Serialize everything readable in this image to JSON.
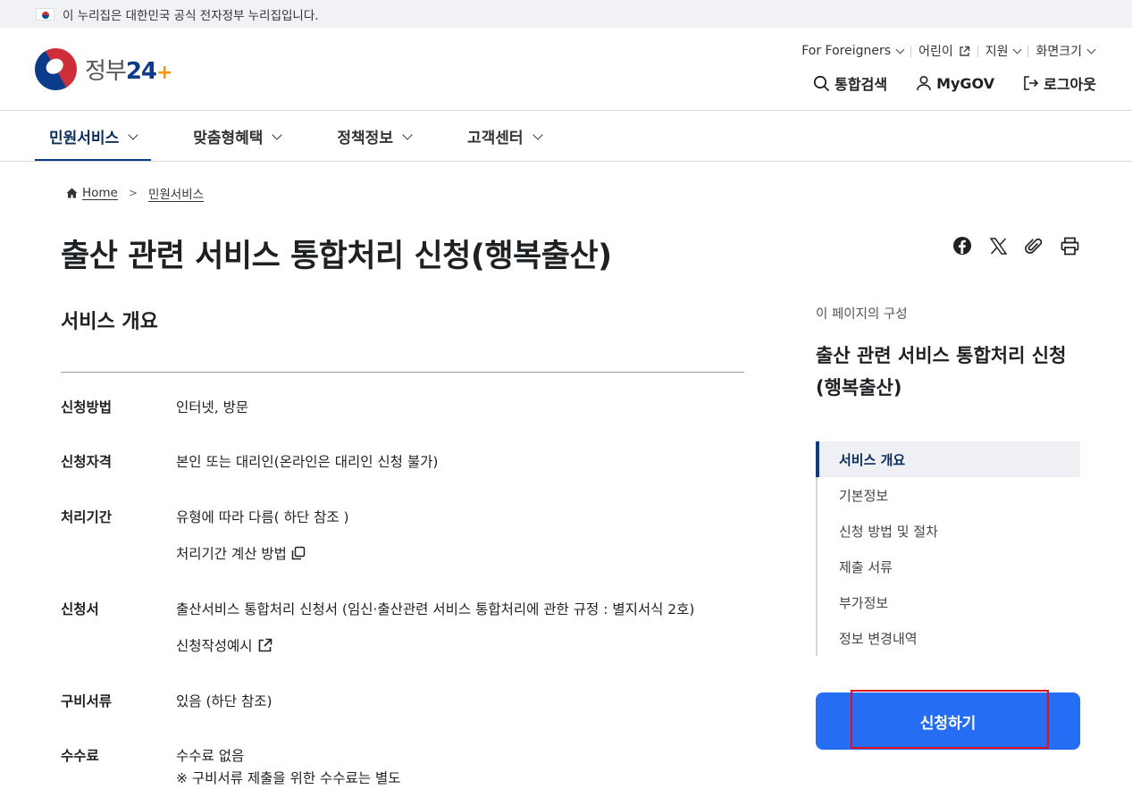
{
  "gov_banner": {
    "text": "이 누리집은 대한민국 공식 전자정부 누리집입니다."
  },
  "logo": {
    "text_main": "정부",
    "text_num": "24",
    "text_plus": "+"
  },
  "utility": [
    {
      "label": "For Foreigners",
      "icon": "chevron-down-icon"
    },
    {
      "label": "어린이",
      "icon": "external-link-icon"
    },
    {
      "label": "지원",
      "icon": "chevron-down-icon"
    },
    {
      "label": "화면크기",
      "icon": "chevron-down-icon"
    }
  ],
  "tools": {
    "search": "통합검색",
    "mygov": "MyGOV",
    "logout": "로그아웃"
  },
  "nav": [
    {
      "label": "민원서비스",
      "active": true
    },
    {
      "label": "맞춤형혜택",
      "active": false
    },
    {
      "label": "정책정보",
      "active": false
    },
    {
      "label": "고객센터",
      "active": false
    }
  ],
  "breadcrumb": {
    "home": "Home",
    "current": "민원서비스"
  },
  "page_title": "출산 관련 서비스 통합처리 신청(행복출산)",
  "section_title": "서비스 개요",
  "overview": {
    "method_label": "신청방법",
    "method_value": "인터넷, 방문",
    "eligibility_label": "신청자격",
    "eligibility_value": "본인 또는 대리인(온라인은 대리인 신청 불가)",
    "period_label": "처리기간",
    "period_value": "유형에 따라 다름( 하단 참조 )",
    "period_link": "처리기간 계산 방법",
    "form_label": "신청서",
    "form_value": "출산서비스 통합처리 신청서 (임신·출산관련 서비스 통합처리에 관한 규정 : 별지서식 2호)",
    "form_link": "신청작성예시",
    "docs_label": "구비서류",
    "docs_value": "있음 (하단 참조)",
    "fee_label": "수수료",
    "fee_value": "수수료 없음",
    "fee_note": "※ 구비서류 제출을 위한 수수료는 별도"
  },
  "toc": {
    "caption": "이 페이지의 구성",
    "title": "출산 관련 서비스 통합처리 신청(행복출산)",
    "items": [
      "서비스 개요",
      "기본정보",
      "신청 방법 및 절차",
      "제출 서류",
      "부가정보",
      "정보 변경내역"
    ]
  },
  "apply_button": "신청하기",
  "colors": {
    "primary": "#256ef4",
    "brand_navy": "#0b3c8c",
    "highlight": "#e0101f"
  }
}
